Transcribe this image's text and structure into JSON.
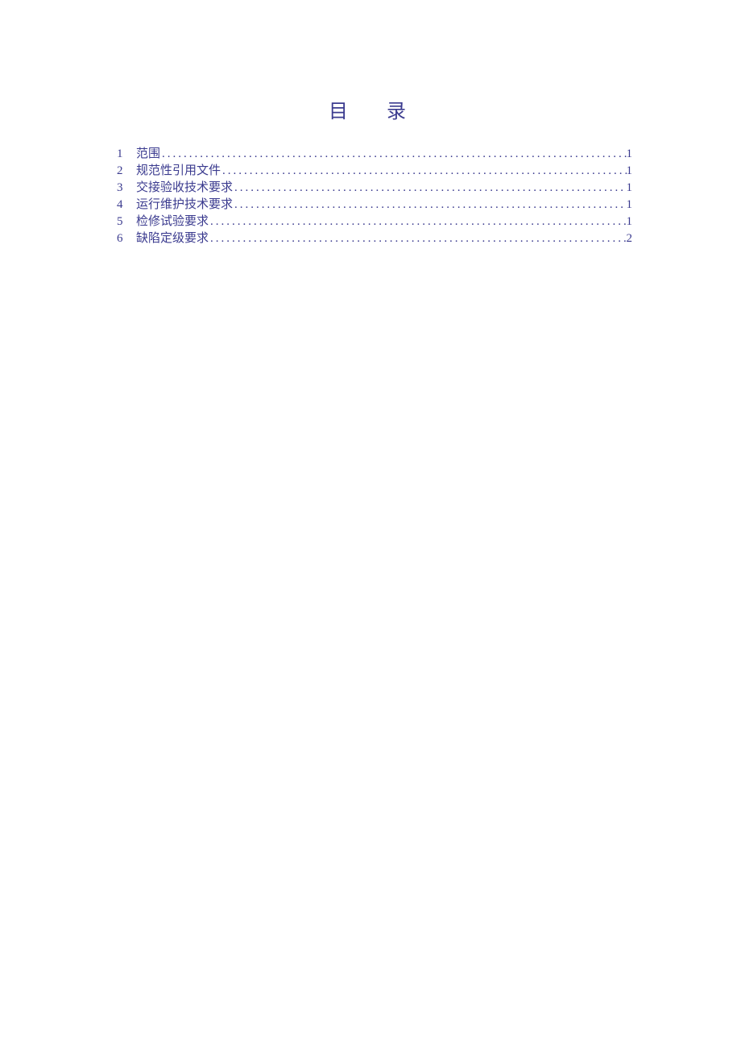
{
  "title": "目录",
  "toc": [
    {
      "number": "1",
      "label": "范围",
      "page": "1"
    },
    {
      "number": "2",
      "label": "规范性引用文件",
      "page": "1"
    },
    {
      "number": "3",
      "label": "交接验收技术要求",
      "page": "1"
    },
    {
      "number": "4",
      "label": "运行维护技术要求",
      "page": "1"
    },
    {
      "number": "5",
      "label": "检修试验要求",
      "page": "1"
    },
    {
      "number": "6",
      "label": "缺陷定级要求",
      "page": "2"
    }
  ]
}
